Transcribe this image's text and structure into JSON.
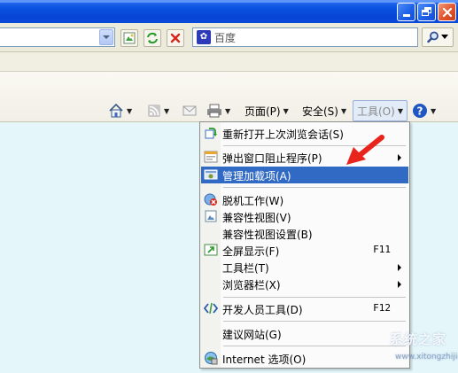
{
  "search": {
    "placeholder": "百度"
  },
  "commandbar": {
    "page": "页面(P)",
    "safety": "安全(S)",
    "tools": "工具(O)"
  },
  "menu": {
    "reopen_session": "重新打开上次浏览会话(S)",
    "popup_blocker": "弹出窗口阻止程序(P)",
    "manage_addons": "管理加载项(A)",
    "work_offline": "脱机工作(W)",
    "compat_view": "兼容性视图(V)",
    "compat_view_settings": "兼容性视图设置(B)",
    "fullscreen": "全屏显示(F)",
    "fullscreen_shortcut": "F11",
    "toolbars": "工具栏(T)",
    "explorer_bars": "浏览器栏(X)",
    "dev_tools": "开发人员工具(D)",
    "dev_tools_shortcut": "F12",
    "suggested_sites": "建议网站(G)",
    "internet_options": "Internet 选项(O)"
  },
  "watermark": {
    "site": "系统之家",
    "url": "www.xitongzhijia.net"
  },
  "colors": {
    "highlight": "#316ac5",
    "annotation": "#e8241c",
    "titlebar": "#0a52e0"
  }
}
